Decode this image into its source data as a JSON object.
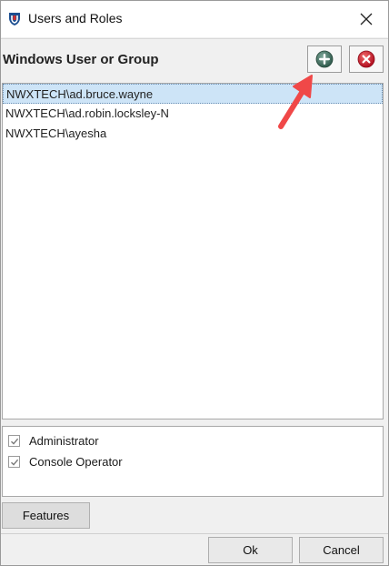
{
  "window": {
    "title": "Users and Roles"
  },
  "header": {
    "label": "Windows User or Group"
  },
  "users": [
    {
      "name": "NWXTECH\\ad.bruce.wayne",
      "selected": true
    },
    {
      "name": "NWXTECH\\ad.robin.locksley-N",
      "selected": false
    },
    {
      "name": "NWXTECH\\ayesha",
      "selected": false
    }
  ],
  "roles": [
    {
      "label": "Administrator",
      "checked": true
    },
    {
      "label": "Console Operator",
      "checked": true
    }
  ],
  "buttons": {
    "features": "Features",
    "ok": "Ok",
    "cancel": "Cancel"
  },
  "colors": {
    "add_icon": "#3d6b5c",
    "remove_icon": "#c8102e",
    "selection": "#cde4f7",
    "annotation_arrow": "#f04848"
  },
  "icons": {
    "add": "plus-circle-icon",
    "remove": "x-circle-icon",
    "close": "close-icon",
    "app": "app-shield-icon"
  }
}
